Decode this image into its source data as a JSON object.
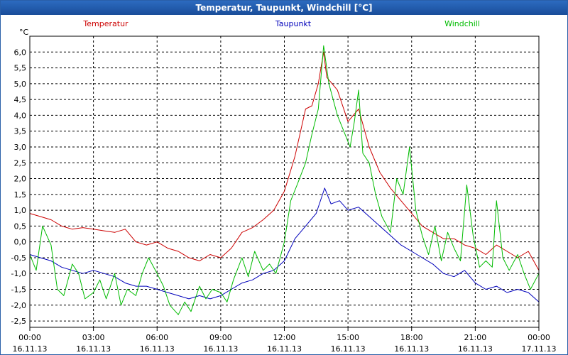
{
  "window": {
    "title": "Temperatur, Taupunkt, Windchill [°C]"
  },
  "colors": {
    "temperatur": "#cc0000",
    "taupunkt": "#0000bb",
    "windchill": "#00bb00",
    "grid": "#000000"
  },
  "chart_data": {
    "type": "line",
    "title": "Temperatur, Taupunkt, Windchill [°C]",
    "ylabel": "°C",
    "ylim": [
      -2.7,
      6.5
    ],
    "grid": true,
    "legend_position": "top",
    "y_ticks": [
      "6,0",
      "5,5",
      "5,0",
      "4,5",
      "4,0",
      "3,5",
      "3,0",
      "2,5",
      "2,0",
      "1,5",
      "1,0",
      "0,5",
      "0,0",
      "-0,5",
      "-1,0",
      "-1,5",
      "-2,0",
      "-2,5"
    ],
    "y_tick_values": [
      6.0,
      5.5,
      5.0,
      4.5,
      4.0,
      3.5,
      3.0,
      2.5,
      2.0,
      1.5,
      1.0,
      0.5,
      0.0,
      -0.5,
      -1.0,
      -1.5,
      -2.0,
      -2.5
    ],
    "x_ticks": [
      {
        "time": "00:00",
        "date": "16.11.13",
        "hour": 0
      },
      {
        "time": "03:00",
        "date": "16.11.13",
        "hour": 3
      },
      {
        "time": "06:00",
        "date": "16.11.13",
        "hour": 6
      },
      {
        "time": "09:00",
        "date": "16.11.13",
        "hour": 9
      },
      {
        "time": "12:00",
        "date": "16.11.13",
        "hour": 12
      },
      {
        "time": "15:00",
        "date": "16.11.13",
        "hour": 15
      },
      {
        "time": "18:00",
        "date": "16.11.13",
        "hour": 18
      },
      {
        "time": "21:00",
        "date": "16.11.13",
        "hour": 21
      },
      {
        "time": "00:00",
        "date": "17.11.13",
        "hour": 24
      }
    ],
    "series": [
      {
        "name": "Temperatur",
        "color": "#cc0000",
        "points": [
          [
            0,
            0.9
          ],
          [
            0.5,
            0.8
          ],
          [
            1,
            0.7
          ],
          [
            1.5,
            0.5
          ],
          [
            2,
            0.4
          ],
          [
            2.5,
            0.45
          ],
          [
            3,
            0.4
          ],
          [
            3.5,
            0.35
          ],
          [
            4,
            0.3
          ],
          [
            4.5,
            0.4
          ],
          [
            5,
            0.0
          ],
          [
            5.5,
            -0.1
          ],
          [
            6,
            0.0
          ],
          [
            6.5,
            -0.2
          ],
          [
            7,
            -0.3
          ],
          [
            7.5,
            -0.5
          ],
          [
            8,
            -0.6
          ],
          [
            8.5,
            -0.4
          ],
          [
            9,
            -0.5
          ],
          [
            9.5,
            -0.2
          ],
          [
            10,
            0.3
          ],
          [
            10.5,
            0.45
          ],
          [
            11,
            0.7
          ],
          [
            11.5,
            1.0
          ],
          [
            12,
            1.6
          ],
          [
            12.5,
            2.7
          ],
          [
            13,
            4.2
          ],
          [
            13.3,
            4.3
          ],
          [
            13.6,
            5.0
          ],
          [
            13.85,
            6.0
          ],
          [
            14,
            5.2
          ],
          [
            14.5,
            4.8
          ],
          [
            15,
            3.8
          ],
          [
            15.5,
            4.2
          ],
          [
            16,
            3.0
          ],
          [
            16.5,
            2.2
          ],
          [
            17,
            1.7
          ],
          [
            17.5,
            1.3
          ],
          [
            18,
            0.9
          ],
          [
            18.5,
            0.5
          ],
          [
            19,
            0.3
          ],
          [
            19.5,
            0.1
          ],
          [
            20,
            0.1
          ],
          [
            20.5,
            -0.1
          ],
          [
            21,
            -0.2
          ],
          [
            21.5,
            -0.4
          ],
          [
            22,
            -0.1
          ],
          [
            22.5,
            -0.3
          ],
          [
            23,
            -0.5
          ],
          [
            23.5,
            -0.3
          ],
          [
            24,
            -0.9
          ]
        ]
      },
      {
        "name": "Taupunkt",
        "color": "#0000bb",
        "points": [
          [
            0,
            -0.4
          ],
          [
            0.5,
            -0.5
          ],
          [
            1,
            -0.6
          ],
          [
            1.5,
            -0.8
          ],
          [
            2,
            -0.9
          ],
          [
            2.5,
            -1.0
          ],
          [
            3,
            -0.9
          ],
          [
            3.5,
            -1.0
          ],
          [
            4,
            -1.1
          ],
          [
            4.5,
            -1.3
          ],
          [
            5,
            -1.4
          ],
          [
            5.5,
            -1.4
          ],
          [
            6,
            -1.5
          ],
          [
            6.5,
            -1.6
          ],
          [
            7,
            -1.7
          ],
          [
            7.5,
            -1.8
          ],
          [
            8,
            -1.7
          ],
          [
            8.5,
            -1.8
          ],
          [
            9,
            -1.7
          ],
          [
            9.5,
            -1.5
          ],
          [
            10,
            -1.3
          ],
          [
            10.5,
            -1.2
          ],
          [
            11,
            -1.0
          ],
          [
            11.5,
            -0.9
          ],
          [
            12,
            -0.6
          ],
          [
            12.5,
            0.1
          ],
          [
            13,
            0.5
          ],
          [
            13.5,
            0.9
          ],
          [
            13.9,
            1.7
          ],
          [
            14.2,
            1.2
          ],
          [
            14.6,
            1.3
          ],
          [
            15,
            1.0
          ],
          [
            15.5,
            1.1
          ],
          [
            16,
            0.8
          ],
          [
            16.5,
            0.5
          ],
          [
            17,
            0.2
          ],
          [
            17.5,
            -0.1
          ],
          [
            18,
            -0.3
          ],
          [
            18.5,
            -0.5
          ],
          [
            19,
            -0.7
          ],
          [
            19.5,
            -1.0
          ],
          [
            20,
            -1.1
          ],
          [
            20.5,
            -0.9
          ],
          [
            21,
            -1.3
          ],
          [
            21.5,
            -1.5
          ],
          [
            22,
            -1.4
          ],
          [
            22.5,
            -1.6
          ],
          [
            23,
            -1.5
          ],
          [
            23.5,
            -1.6
          ],
          [
            24,
            -1.9
          ]
        ]
      },
      {
        "name": "Windchill",
        "color": "#00bb00",
        "points": [
          [
            0,
            -0.4
          ],
          [
            0.3,
            -0.9
          ],
          [
            0.6,
            0.5
          ],
          [
            1,
            -0.1
          ],
          [
            1.3,
            -1.5
          ],
          [
            1.6,
            -1.7
          ],
          [
            2,
            -0.7
          ],
          [
            2.3,
            -1.0
          ],
          [
            2.6,
            -1.8
          ],
          [
            3,
            -1.6
          ],
          [
            3.3,
            -1.2
          ],
          [
            3.6,
            -1.8
          ],
          [
            4,
            -1.0
          ],
          [
            4.3,
            -2.0
          ],
          [
            4.6,
            -1.5
          ],
          [
            5,
            -1.7
          ],
          [
            5.3,
            -1.0
          ],
          [
            5.6,
            -0.5
          ],
          [
            6,
            -1.0
          ],
          [
            6.3,
            -1.4
          ],
          [
            6.6,
            -2.0
          ],
          [
            7,
            -2.3
          ],
          [
            7.3,
            -1.9
          ],
          [
            7.6,
            -2.2
          ],
          [
            8,
            -1.4
          ],
          [
            8.3,
            -1.8
          ],
          [
            8.6,
            -1.5
          ],
          [
            9,
            -1.6
          ],
          [
            9.3,
            -1.9
          ],
          [
            9.6,
            -1.2
          ],
          [
            10,
            -0.5
          ],
          [
            10.3,
            -1.1
          ],
          [
            10.6,
            -0.3
          ],
          [
            11,
            -0.9
          ],
          [
            11.3,
            -0.7
          ],
          [
            11.6,
            -1.0
          ],
          [
            12,
            0.0
          ],
          [
            12.3,
            1.3
          ],
          [
            12.6,
            1.8
          ],
          [
            13,
            2.5
          ],
          [
            13.3,
            3.4
          ],
          [
            13.6,
            4.2
          ],
          [
            13.85,
            6.2
          ],
          [
            14.1,
            5.0
          ],
          [
            14.5,
            4.0
          ],
          [
            14.8,
            3.5
          ],
          [
            15.1,
            3.0
          ],
          [
            15.3,
            3.8
          ],
          [
            15.5,
            4.8
          ],
          [
            15.7,
            2.8
          ],
          [
            16,
            2.5
          ],
          [
            16.3,
            1.5
          ],
          [
            16.6,
            0.8
          ],
          [
            17,
            0.3
          ],
          [
            17.3,
            2.0
          ],
          [
            17.6,
            1.5
          ],
          [
            17.9,
            3.0
          ],
          [
            18.2,
            1.0
          ],
          [
            18.5,
            0.2
          ],
          [
            18.8,
            -0.4
          ],
          [
            19.1,
            0.5
          ],
          [
            19.4,
            -0.6
          ],
          [
            19.7,
            0.3
          ],
          [
            20,
            -0.2
          ],
          [
            20.3,
            -0.6
          ],
          [
            20.6,
            1.8
          ],
          [
            20.9,
            0.2
          ],
          [
            21.2,
            -0.8
          ],
          [
            21.5,
            -0.6
          ],
          [
            21.8,
            -0.8
          ],
          [
            22,
            1.3
          ],
          [
            22.3,
            -0.5
          ],
          [
            22.6,
            -0.9
          ],
          [
            23,
            -0.4
          ],
          [
            23.3,
            -1.0
          ],
          [
            23.6,
            -1.5
          ],
          [
            24,
            -1.0
          ]
        ]
      }
    ]
  }
}
